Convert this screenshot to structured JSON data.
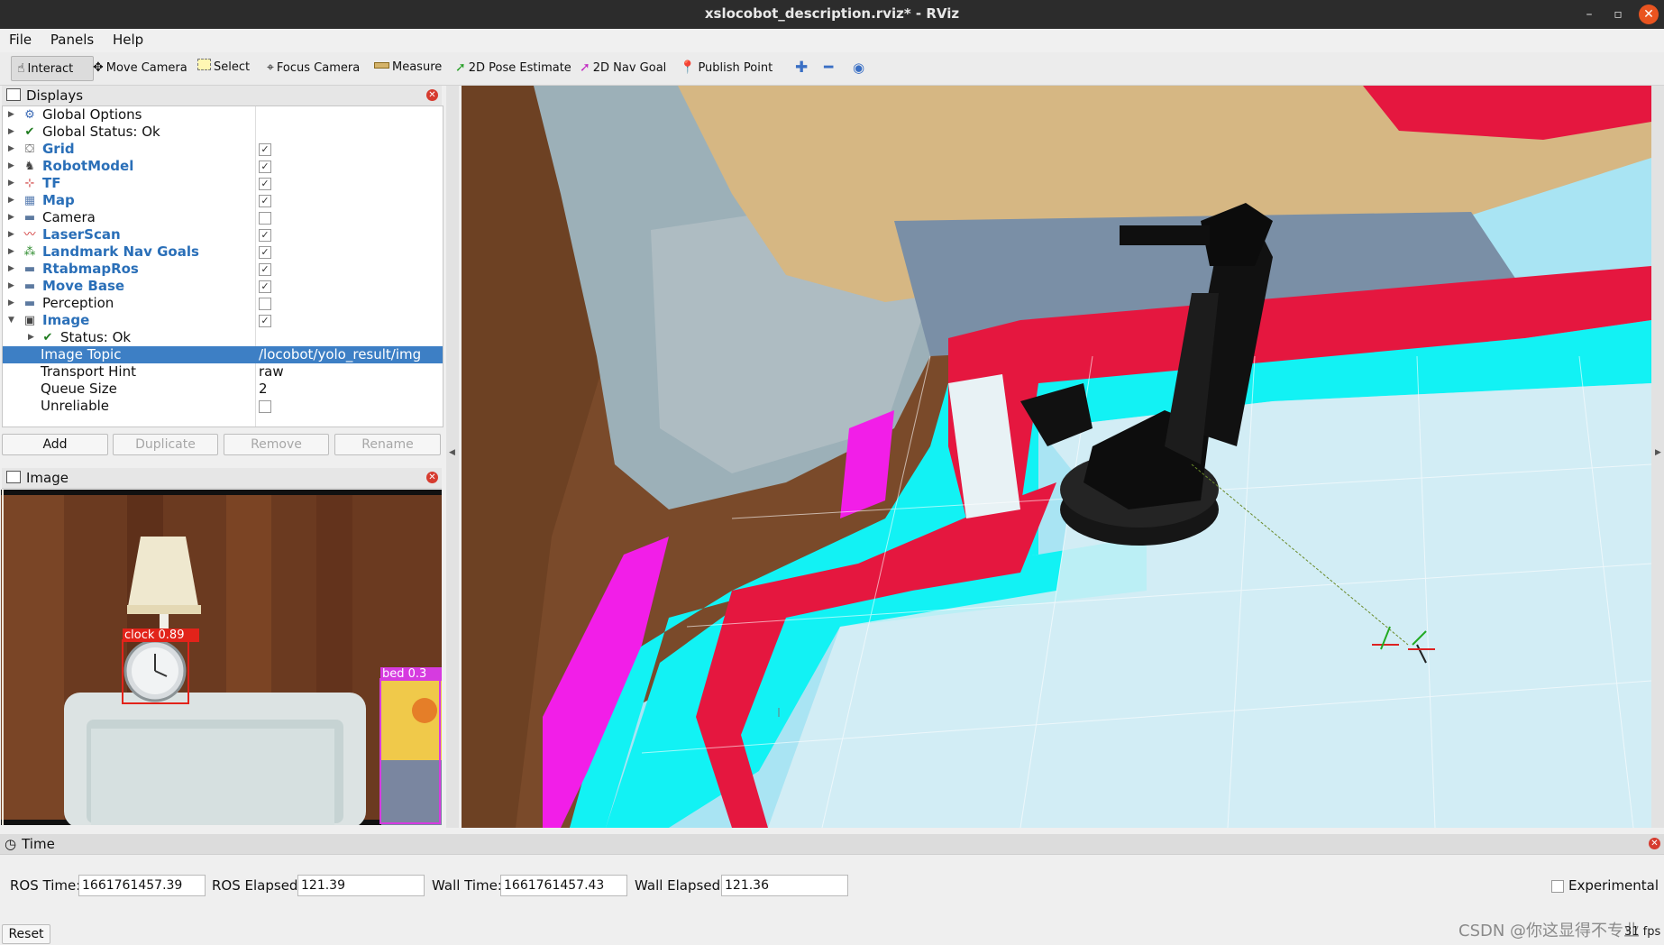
{
  "window": {
    "title": "xslocobot_description.rviz* - RViz"
  },
  "menu": [
    "File",
    "Panels",
    "Help"
  ],
  "toolbar": {
    "tools": [
      {
        "label": "Interact",
        "icon": "interact-icon"
      },
      {
        "label": "Move Camera",
        "icon": "move-camera-icon"
      },
      {
        "label": "Select",
        "icon": "select-icon"
      },
      {
        "label": "Focus Camera",
        "icon": "focus-camera-icon"
      },
      {
        "label": "Measure",
        "icon": "measure-icon"
      },
      {
        "label": "2D Pose Estimate",
        "icon": "pose-estimate-icon"
      },
      {
        "label": "2D Nav Goal",
        "icon": "nav-goal-icon"
      },
      {
        "label": "Publish Point",
        "icon": "publish-point-icon"
      }
    ],
    "active": "Interact"
  },
  "displays": {
    "title": "Displays",
    "items": [
      {
        "label": "Global Options",
        "checked": null
      },
      {
        "label": "Global Status: Ok",
        "checked": null
      },
      {
        "label": "Grid",
        "checked": true
      },
      {
        "label": "RobotModel",
        "checked": true
      },
      {
        "label": "TF",
        "checked": true
      },
      {
        "label": "Map",
        "checked": true
      },
      {
        "label": "Camera",
        "checked": false
      },
      {
        "label": "LaserScan",
        "checked": true
      },
      {
        "label": "Landmark Nav Goals",
        "checked": true
      },
      {
        "label": "RtabmapRos",
        "checked": true
      },
      {
        "label": "Move Base",
        "checked": true
      },
      {
        "label": "Perception",
        "checked": false
      },
      {
        "label": "Image",
        "checked": true
      }
    ],
    "image_children": [
      {
        "label": "Status: Ok",
        "value": ""
      },
      {
        "label": "Image Topic",
        "value": "/locobot/yolo_result/img"
      },
      {
        "label": "Transport Hint",
        "value": "raw"
      },
      {
        "label": "Queue Size",
        "value": "2"
      },
      {
        "label": "Unreliable",
        "value": ""
      }
    ],
    "buttons": {
      "add": "Add",
      "duplicate": "Duplicate",
      "remove": "Remove",
      "rename": "Rename"
    }
  },
  "image_panel": {
    "title": "Image",
    "detections": [
      {
        "label": "clock",
        "score": "0.89",
        "text": "clock  0.89",
        "color": "#e2231a"
      },
      {
        "label": "bed",
        "score": "0.3",
        "text": "bed  0.3",
        "color": "#d63be0"
      }
    ]
  },
  "time_panel": {
    "title": "Time",
    "ros_time_label": "ROS Time:",
    "ros_time": "1661761457.39",
    "ros_elapsed_label": "ROS Elapsed:",
    "ros_elapsed": "121.39",
    "wall_time_label": "Wall Time:",
    "wall_time": "1661761457.43",
    "wall_elapsed_label": "Wall Elapsed:",
    "wall_elapsed": "121.36",
    "experimental_label": "Experimental",
    "reset_label": "Reset",
    "fps": "31 fps"
  },
  "watermark": "CSDN @你这显得不专业",
  "colors": {
    "selection": "#3d7fc5",
    "display_label_blue": "#2a6fb8",
    "costmap_cyan": "#12f2f4",
    "costmap_red": "#e5173f",
    "costmap_magenta": "#f21ee8",
    "floor": "#a9e4f3"
  }
}
